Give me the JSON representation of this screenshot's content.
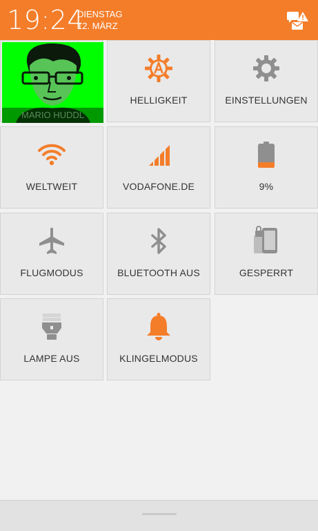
{
  "status": {
    "time": "19:24",
    "day": "DIENSTAG",
    "date": "12. MÄRZ"
  },
  "tiles": {
    "profile": "MARIO HUDDL",
    "brightness": "HELLIGKEIT",
    "settings": "EINSTELLUNGEN",
    "wifi": "WELTWEIT",
    "network": "VODAFONE.DE",
    "battery": "9%",
    "airplane": "FLUGMODUS",
    "bluetooth": "BLUETOOTH AUS",
    "lock": "GESPERRT",
    "flashlight": "LAMPE AUS",
    "ringer": "KLINGELMODUS"
  },
  "battery_level": 0.09,
  "colors": {
    "accent": "#f47d2a",
    "icon_gray": "#8f8f8f",
    "tile_bg": "#e9e9e9",
    "profile_bg": "#00ff00"
  },
  "icons": {
    "header": "message-alert-icon",
    "brightness": "auto-brightness-icon",
    "settings": "gear-icon",
    "wifi": "wifi-icon",
    "network": "signal-icon",
    "battery": "battery-icon",
    "airplane": "airplane-icon",
    "bluetooth": "bluetooth-icon",
    "lock": "phone-lock-icon",
    "flashlight": "flashlight-icon",
    "ringer": "bell-icon"
  }
}
